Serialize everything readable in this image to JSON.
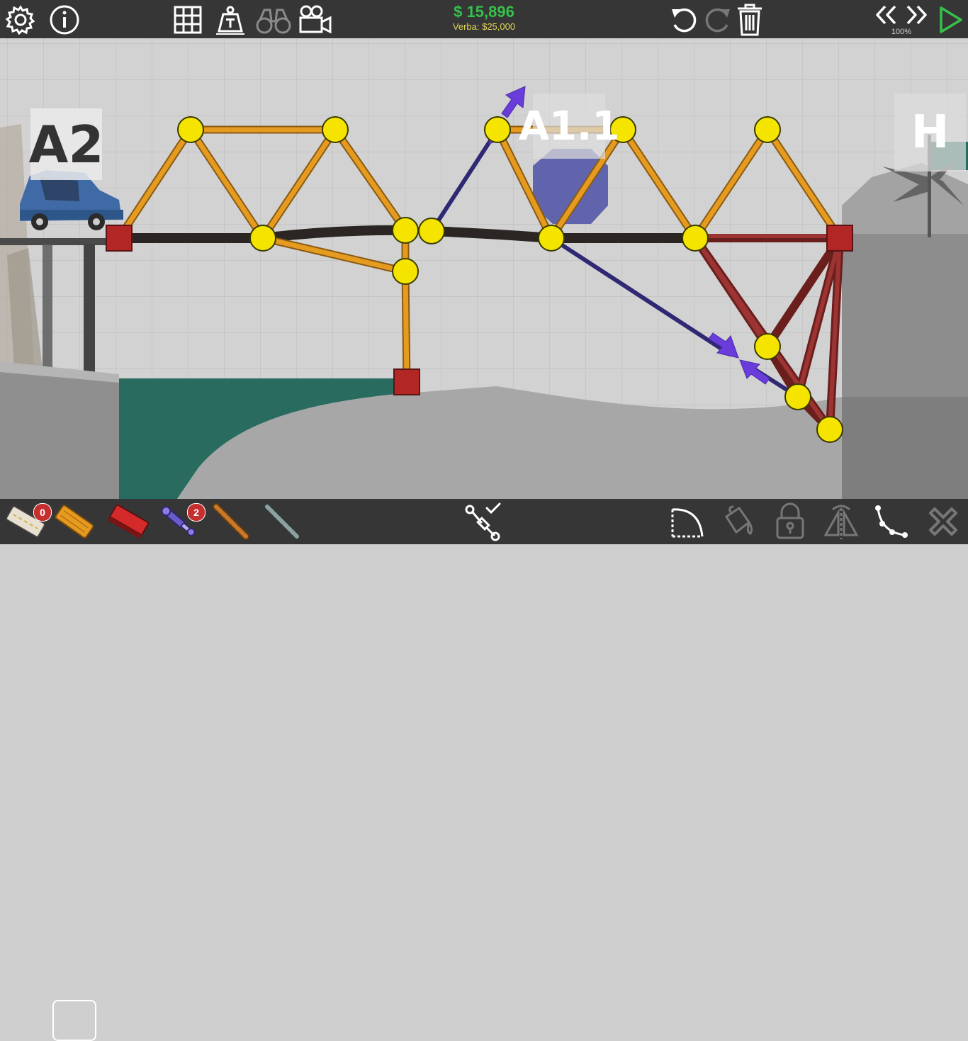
{
  "toolbar": {
    "settings_icon": "gear-icon",
    "info_icon": "info-icon",
    "grid_icon": "grid-icon",
    "weight_icon": "weight-t-icon",
    "binoculars_icon": "binoculars-icon",
    "camera_icon": "video-camera-icon",
    "undo_icon": "undo-icon",
    "redo_icon": "redo-icon",
    "trash_icon": "trash-icon",
    "rewind_icon": "rewind-icon",
    "fast_forward_icon": "fast-forward-icon",
    "play_icon": "play-icon",
    "speed": "100%"
  },
  "budget": {
    "amount": "$ 15,896",
    "label": "Verba: $25,000"
  },
  "signs": {
    "start": "A2",
    "checkpoint": "A1.1",
    "finish": "H"
  },
  "materials": [
    {
      "name": "road",
      "count": "0"
    },
    {
      "name": "wood",
      "selected": true
    },
    {
      "name": "reinforced-road"
    },
    {
      "name": "hydraulics",
      "count": "2"
    },
    {
      "name": "rope"
    },
    {
      "name": "steel-cable"
    }
  ],
  "bottom_tools": {
    "hydraulic_controller_icon": "hydraulic-check-icon",
    "arc_icon": "arc-tool-icon",
    "paint_icon": "paint-bucket-icon",
    "lock_icon": "lock-icon",
    "mirror_icon": "mirror-icon",
    "split_icon": "split-joint-icon",
    "delete_icon": "close-x-icon"
  },
  "colors": {
    "wood": "#e0951e",
    "road": "#2b2523",
    "steel": "#8a2c2a",
    "hydraulic": "#3a2f8a",
    "joint": "#f5e400",
    "anchor": "#b32626",
    "money": "#35c14b",
    "water": "#2a6b5f"
  }
}
